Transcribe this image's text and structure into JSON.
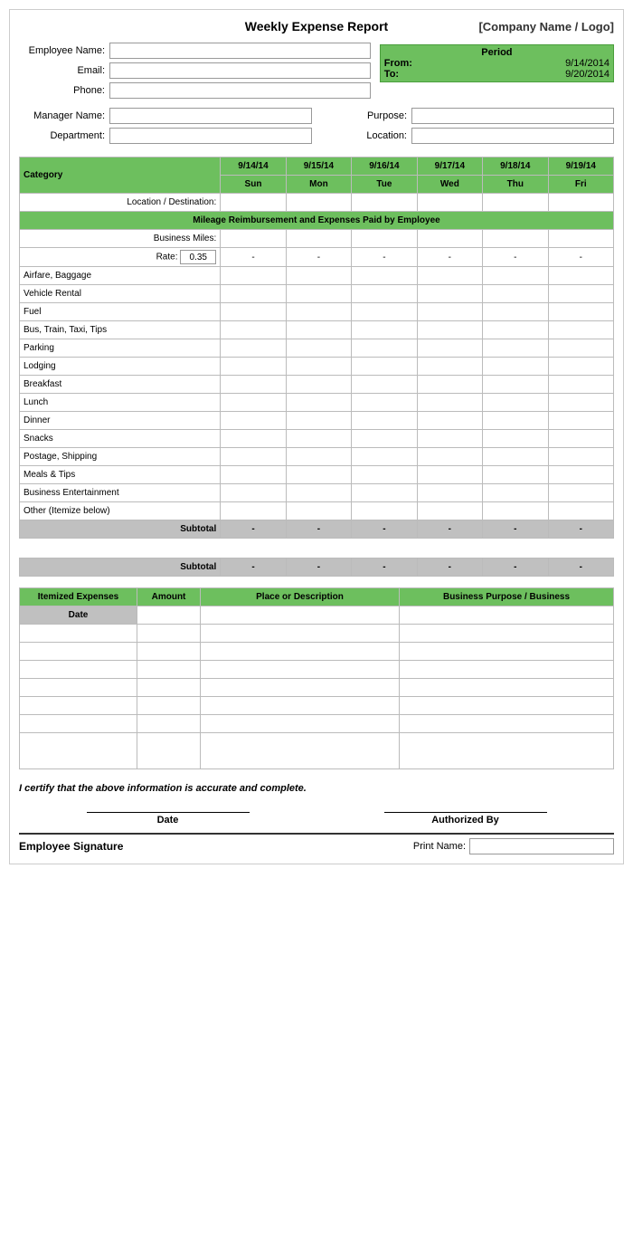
{
  "header": {
    "title": "Weekly Expense Report",
    "company": "[Company Name / Logo]"
  },
  "fields": {
    "employee_name_label": "Employee Name:",
    "email_label": "Email:",
    "phone_label": "Phone:",
    "manager_name_label": "Manager Name:",
    "department_label": "Department:",
    "purpose_label": "Purpose:",
    "location_label": "Location:"
  },
  "period": {
    "title": "Period",
    "from_label": "From:",
    "from_date": "9/14/2014",
    "to_label": "To:",
    "to_date": "9/20/2014"
  },
  "grid": {
    "category_label": "Category",
    "location_destination_label": "Location / Destination:",
    "mileage_section_label": "Mileage Reimbursement and Expenses Paid by Employee",
    "business_miles_label": "Business Miles:",
    "rate_label": "Rate:",
    "rate_value": "0.35",
    "days": [
      {
        "date": "9/14/14",
        "day": "Sun"
      },
      {
        "date": "9/15/14",
        "day": "Mon"
      },
      {
        "date": "9/16/14",
        "day": "Tue"
      },
      {
        "date": "9/17/14",
        "day": "Wed"
      },
      {
        "date": "9/18/14",
        "day": "Thu"
      },
      {
        "date": "9/19/14",
        "day": "Fri"
      }
    ],
    "categories": [
      "Airfare, Baggage",
      "Vehicle Rental",
      "Fuel",
      "Bus, Train, Taxi, Tips",
      "Parking",
      "Lodging",
      "Breakfast",
      "Lunch",
      "Dinner",
      "Snacks",
      "Postage, Shipping",
      "Meals & Tips",
      "Business Entertainment",
      "Other (Itemize below)"
    ],
    "subtotal_label": "Subtotal",
    "dash": "-"
  },
  "itemized": {
    "header": "Itemized Expenses",
    "amount_label": "Amount",
    "place_label": "Place or Description",
    "business_purpose_label": "Business Purpose / Business",
    "date_label": "Date",
    "rows": 8
  },
  "certify": {
    "text": "I certify that the above information is accurate and complete."
  },
  "signature": {
    "date_label": "Date",
    "authorized_by_label": "Authorized By",
    "employee_signature_label": "Employee Signature",
    "print_name_label": "Print Name:"
  }
}
